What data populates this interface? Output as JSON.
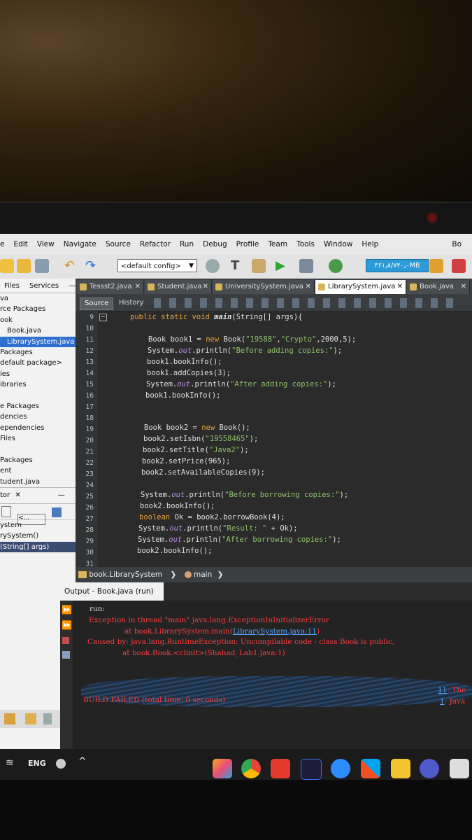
{
  "menubar": {
    "items": [
      "e",
      "Edit",
      "View",
      "Navigate",
      "Source",
      "Refactor",
      "Run",
      "Debug",
      "Profile",
      "Team",
      "Tools",
      "Window",
      "Help"
    ],
    "right": "Bo"
  },
  "toolbar": {
    "config": "<default config>",
    "memory": "۳۶۱٫۸/۷۲۰٫۰MB"
  },
  "left_panel": {
    "tabs": [
      "Files",
      "Services"
    ],
    "tree": [
      "va",
      "rce Packages",
      "ook",
      "Book.java",
      "LibrarySystem.java",
      "Packages",
      "default package>",
      "ies",
      "ibraries",
      "",
      "e Packages",
      "dencies",
      "ependencies",
      "Files",
      "",
      "Packages",
      "ent",
      "tudent.java"
    ],
    "selected_index": 4,
    "navigator_title": "tor",
    "navigator_items": [
      "ystem",
      "rySystem()",
      "(String[] args)"
    ]
  },
  "editor": {
    "tabs": [
      "Tessst2.java",
      "Student.java",
      "UniversitySystem.java",
      "LibrarySystem.java",
      "Book.java"
    ],
    "active_tab": 3,
    "source_label": "Source",
    "history_label": "History",
    "line_numbers": [
      "9",
      "10",
      "11",
      "12",
      "13",
      "14",
      "15",
      "16",
      "17",
      "18",
      "19",
      "20",
      "21",
      "22",
      "23",
      "24",
      "25",
      "26",
      "27",
      "28",
      "29",
      "30",
      "31"
    ],
    "breadcrumb": [
      "book.LibrarySystem",
      "main"
    ]
  },
  "code": {
    "l9": [
      "public static void ",
      "main",
      "(String[] args){"
    ],
    "l11a": "Book book1 = ",
    "l11kw": "new",
    "l11b": " Book(",
    "l11s1": "\"19588\"",
    "l11c": ",",
    "l11s2": "\"Crypto\"",
    "l11d": ",2000,5);",
    "l12a": "System.",
    "l12f": "out",
    "l12b": ".println(",
    "l12s": "\"Before adding copies:\"",
    "l12c": ");",
    "l13": "book1.bookInfo();",
    "l14": "book1.addCopies(3);",
    "l15a": "System.",
    "l15f": "out",
    "l15b": ".println(",
    "l15s": "\"After adding copies:\"",
    "l15c": ");",
    "l16": "book1.bookInfo();",
    "l19a": "Book book2 = ",
    "l19kw": "new",
    "l19b": " Book();",
    "l20a": "book2.setIsbn(",
    "l20s": "\"19558465\"",
    "l20b": ");",
    "l21a": "book2.setTitle(",
    "l21s": "\"Java2\"",
    "l21b": ");",
    "l22": "book2.setPrice(965);",
    "l23": "book2.setAvailableCopies(9);",
    "l25a": "System.",
    "l25f": "out",
    "l25b": ".println(",
    "l25s": "\"Before borrowing copies:\"",
    "l25c": ");",
    "l26": "book2.bookInfo();",
    "l27kw": "boolean",
    "l27b": " Ok = book2.borrowBook(4);",
    "l28a": "System.",
    "l28f": "out",
    "l28b": ".println(",
    "l28s": "\"Result: \"",
    "l28c": " + Ok);",
    "l29a": "System.",
    "l29f": "out",
    "l29b": ".println(",
    "l29s": "\"After borrowing copies:\"",
    "l29c": ");",
    "l30": "book2.bookInfo();"
  },
  "output": {
    "title": "Output - Book.java (run)",
    "run": "run:",
    "err1": "Exception in thread \"main\" java.lang.ExceptionInInitializerError",
    "err2a": "at book.LibrarySystem.main(",
    "err2link": "LibrarySystem.java:11",
    "err2b": ")",
    "err3": "Caused by: java.lang.RuntimeException: Uncompilable code - class Book is public,",
    "err4": "at book.Book.<clinit>(Shahad_Lab1.java:1)",
    "right1a": "11",
    "right1b": ": The",
    "right2a": "1",
    "right2b": ": Java",
    "build": "BUILD FAILED (total time: 0 seconds)"
  },
  "taskbar": {
    "lang": "ENG"
  }
}
